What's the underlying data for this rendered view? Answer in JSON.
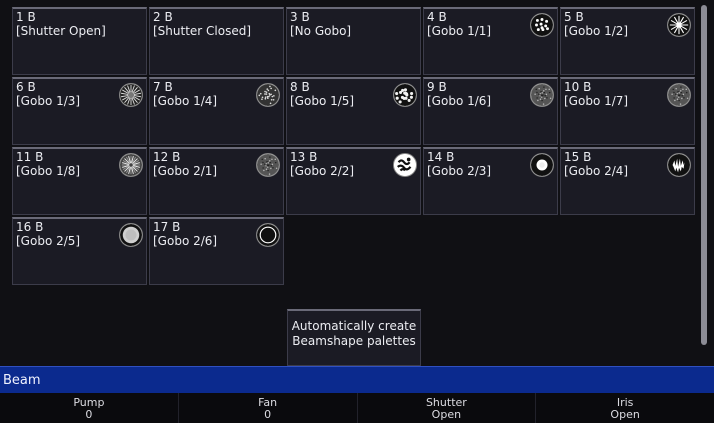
{
  "palettes": [
    {
      "number": "1 B",
      "label": "[Shutter Open]",
      "icon": ""
    },
    {
      "number": "2 B",
      "label": "[Shutter Closed]",
      "icon": ""
    },
    {
      "number": "3 B",
      "label": "[No Gobo]",
      "icon": ""
    },
    {
      "number": "4 B",
      "label": "[Gobo 1/1]",
      "icon": "gobo-dots-icon"
    },
    {
      "number": "5 B",
      "label": "[Gobo 1/2]",
      "icon": "gobo-star-icon"
    },
    {
      "number": "6 B",
      "label": "[Gobo 1/3]",
      "icon": "gobo-radial-icon"
    },
    {
      "number": "7 B",
      "label": "[Gobo 1/4]",
      "icon": "gobo-speckle-icon"
    },
    {
      "number": "8 B",
      "label": "[Gobo 1/5]",
      "icon": "gobo-cells-icon"
    },
    {
      "number": "9 B",
      "label": "[Gobo 1/6]",
      "icon": "gobo-texture-icon"
    },
    {
      "number": "10 B",
      "label": "[Gobo 1/7]",
      "icon": "gobo-texture-icon"
    },
    {
      "number": "11 B",
      "label": "[Gobo 1/8]",
      "icon": "gobo-burst-icon"
    },
    {
      "number": "12 B",
      "label": "[Gobo 2/1]",
      "icon": "gobo-texture-icon"
    },
    {
      "number": "13 B",
      "label": "[Gobo 2/2]",
      "icon": "gobo-breakup-icon"
    },
    {
      "number": "14 B",
      "label": "[Gobo 2/3]",
      "icon": "gobo-ring-icon"
    },
    {
      "number": "15 B",
      "label": "[Gobo 2/4]",
      "icon": "gobo-flame-icon"
    },
    {
      "number": "16 B",
      "label": "[Gobo 2/5]",
      "icon": "gobo-soft-disc-icon"
    },
    {
      "number": "17 B",
      "label": "[Gobo 2/6]",
      "icon": "gobo-thin-ring-icon"
    }
  ],
  "auto_button": {
    "label": "Automatically create Beamshape palettes"
  },
  "section_title": "Beam",
  "encoders": [
    {
      "name": "Pump",
      "value": "0"
    },
    {
      "name": "Fan",
      "value": "0"
    },
    {
      "name": "Shutter",
      "value": "Open"
    },
    {
      "name": "Iris",
      "value": "Open"
    }
  ],
  "colors": {
    "accent_bar": "#0b2a8e",
    "tile_bg": "#1b1b24",
    "background": "#101014"
  }
}
